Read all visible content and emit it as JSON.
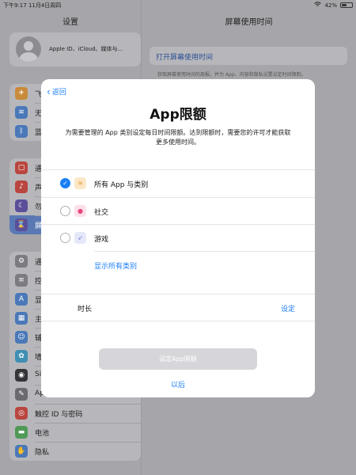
{
  "status": {
    "time_date": "下午9:17  11月4日周四",
    "battery": "42%",
    "battery_level": 0.42
  },
  "sidebar": {
    "title": "设置",
    "profile_text": "Apple ID、iCloud、媒体与...",
    "groups": [
      [
        {
          "label": "飞",
          "icon": "airplane-icon",
          "color": "#c98a3a"
        },
        {
          "label": "无",
          "icon": "wifi-icon",
          "color": "#4a78b8"
        },
        {
          "label": "蓝",
          "icon": "bluetooth-icon",
          "color": "#4a78b8"
        }
      ],
      [
        {
          "label": "通",
          "icon": "notifications-icon",
          "color": "#b9463f"
        },
        {
          "label": "声",
          "icon": "sounds-icon",
          "color": "#b9463f"
        },
        {
          "label": "勿",
          "icon": "focus-moon-icon",
          "color": "#5b4f9a"
        },
        {
          "label": "屏",
          "icon": "hourglass-icon",
          "color": "#5b4f9a"
        }
      ],
      [
        {
          "label": "通",
          "icon": "gear-icon",
          "color": "#7b7b80"
        },
        {
          "label": "控",
          "icon": "control-center-icon",
          "color": "#7b7b80"
        },
        {
          "label": "显",
          "icon": "display-icon",
          "color": "#4a78b8"
        },
        {
          "label": "主",
          "icon": "home-screen-icon",
          "color": "#4a78b8"
        },
        {
          "label": "辅",
          "icon": "accessibility-icon",
          "color": "#4a78b8"
        },
        {
          "label": "墙",
          "icon": "wallpaper-icon",
          "color": "#3f8fb3"
        },
        {
          "label": "Si",
          "icon": "siri-icon",
          "color": "#333338"
        },
        {
          "label": "Apple Pencil",
          "icon": "pencil-icon",
          "color": "#6a6a6f"
        },
        {
          "label": "触控 ID 与密码",
          "icon": "fingerprint-icon",
          "color": "#b9463f"
        },
        {
          "label": "电池",
          "icon": "battery-icon",
          "color": "#4f9a56"
        },
        {
          "label": "隐私",
          "icon": "privacy-hand-icon",
          "color": "#4a78b8"
        }
      ]
    ]
  },
  "detail": {
    "title": "屏幕使用时间",
    "card_link": "打开屏幕使用时间",
    "desc": "获取屏幕使用时间的周报，并为 App、内容和隐私设置设定时间限制。"
  },
  "modal": {
    "back_label": "返回",
    "title": "App限额",
    "description": "为需要管理的 App 类别设定每日时间限额。达到限额时，需要您的许可才能获取更多使用时间。",
    "options": [
      {
        "label": "所有 App 与类别",
        "checked": true,
        "icon": "stack-icon",
        "icon_color": "#e9a23b"
      },
      {
        "label": "社交",
        "checked": false,
        "icon": "chat-bubble-icon",
        "icon_color": "#e8457a"
      },
      {
        "label": "游戏",
        "checked": false,
        "icon": "rocket-icon",
        "icon_color": "#6e7bd8"
      }
    ],
    "show_all": "显示所有类别",
    "duration_label": "时长",
    "duration_action": "设定",
    "primary_button": "设定App限额",
    "secondary_button": "以后"
  }
}
